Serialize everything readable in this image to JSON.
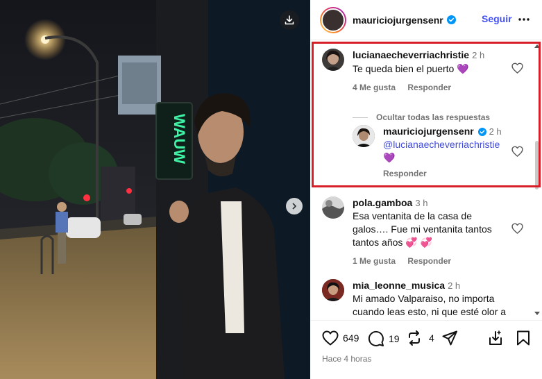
{
  "post": {
    "author": "mauriciojurgensenr",
    "follow_label": "Seguir",
    "sign_text": "WAUW",
    "likes": "649",
    "comments_count": "19",
    "shares": "4",
    "time_ago": "Hace 4 horas"
  },
  "comments": [
    {
      "user": "lucianaecheverriachristie",
      "time": "2 h",
      "text": "Te queda bien el puerto 💜",
      "likes": "4 Me gusta",
      "reply": "Responder",
      "hide_replies": "Ocultar todas las respuestas",
      "replies": [
        {
          "user": "mauriciojurgensenr",
          "time": "2 h",
          "mention": "@lucianaecheverriachristie",
          "text": "💜",
          "reply": "Responder"
        }
      ]
    },
    {
      "user": "pola.gamboa",
      "time": "3 h",
      "text": "Esa ventanita de la casa de galos…. Fue mi ventanita tantos tantos años 💞 💞",
      "likes": "1 Me gusta",
      "reply": "Responder"
    },
    {
      "user": "mia_leonne_musica",
      "time": "2 h",
      "text": "Mi amado Valparaiso, no importa cuando leas esto, ni que esté olor a"
    }
  ],
  "colors": {
    "follow": "#4150f7",
    "highlight": "#d81e29",
    "verified": "#0095f6",
    "sign_neon": "#3ef5a6"
  },
  "icons": [
    "download-icon",
    "chevron-right-icon",
    "verified-icon",
    "more-icon",
    "heart-icon",
    "comment-icon",
    "repost-icon",
    "share-icon",
    "save-icon",
    "bookmark-icon"
  ]
}
